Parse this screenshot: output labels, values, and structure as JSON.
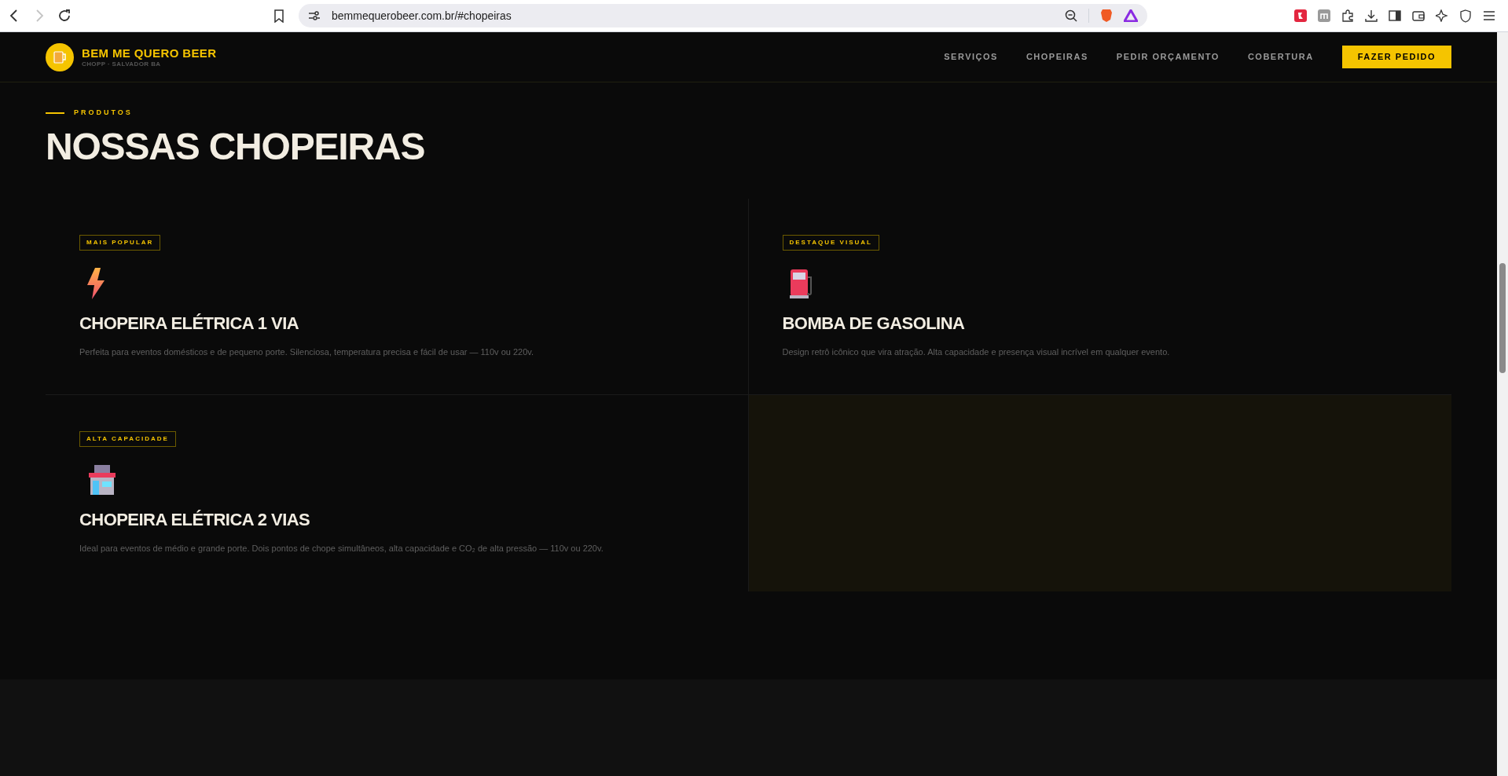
{
  "browser": {
    "nav": [
      {
        "kind": "back",
        "disabled": false
      },
      {
        "kind": "forward",
        "disabled": true
      },
      {
        "kind": "reload",
        "disabled": false
      }
    ],
    "url": "bemmequerobeer.com.br/#chopeiras"
  },
  "site_header": {
    "brand": "BEM ME QUERO BEER",
    "tagline": "CHOPP · SALVADOR BA",
    "nav": [
      "SERVIÇOS",
      "CHOPEIRAS",
      "PEDIR ORÇAMENTO",
      "COBERTURA"
    ],
    "cta": "FAZER PEDIDO"
  },
  "section": {
    "eyebrow": "PRODUTOS",
    "title": "NOSSAS CHOPEIRAS",
    "products": [
      {
        "badge": "MAIS POPULAR",
        "kind": "bolt",
        "title": "CHOPEIRA ELÉTRICA 1 VIA",
        "description": "Perfeita para eventos domésticos e de pequeno porte. Silenciosa, temperatura precisa e fácil de usar — 110v ou 220v."
      },
      {
        "badge": "DESTAQUE VISUAL",
        "kind": "fuel",
        "title": "BOMBA DE GASOLINA",
        "description": "Design retrô icônico que vira atração. Alta capacidade e presença visual incrível em qualquer evento."
      },
      {
        "badge": "ALTA CAPACIDADE",
        "kind": "store",
        "title": "CHOPEIRA ELÉTRICA 2 VIAS",
        "description": "Ideal para eventos de médio e grande porte. Dois pontos de chope simultâneos, alta capacidade e CO₂ de alta pressão — 110v ou 220v."
      }
    ]
  }
}
